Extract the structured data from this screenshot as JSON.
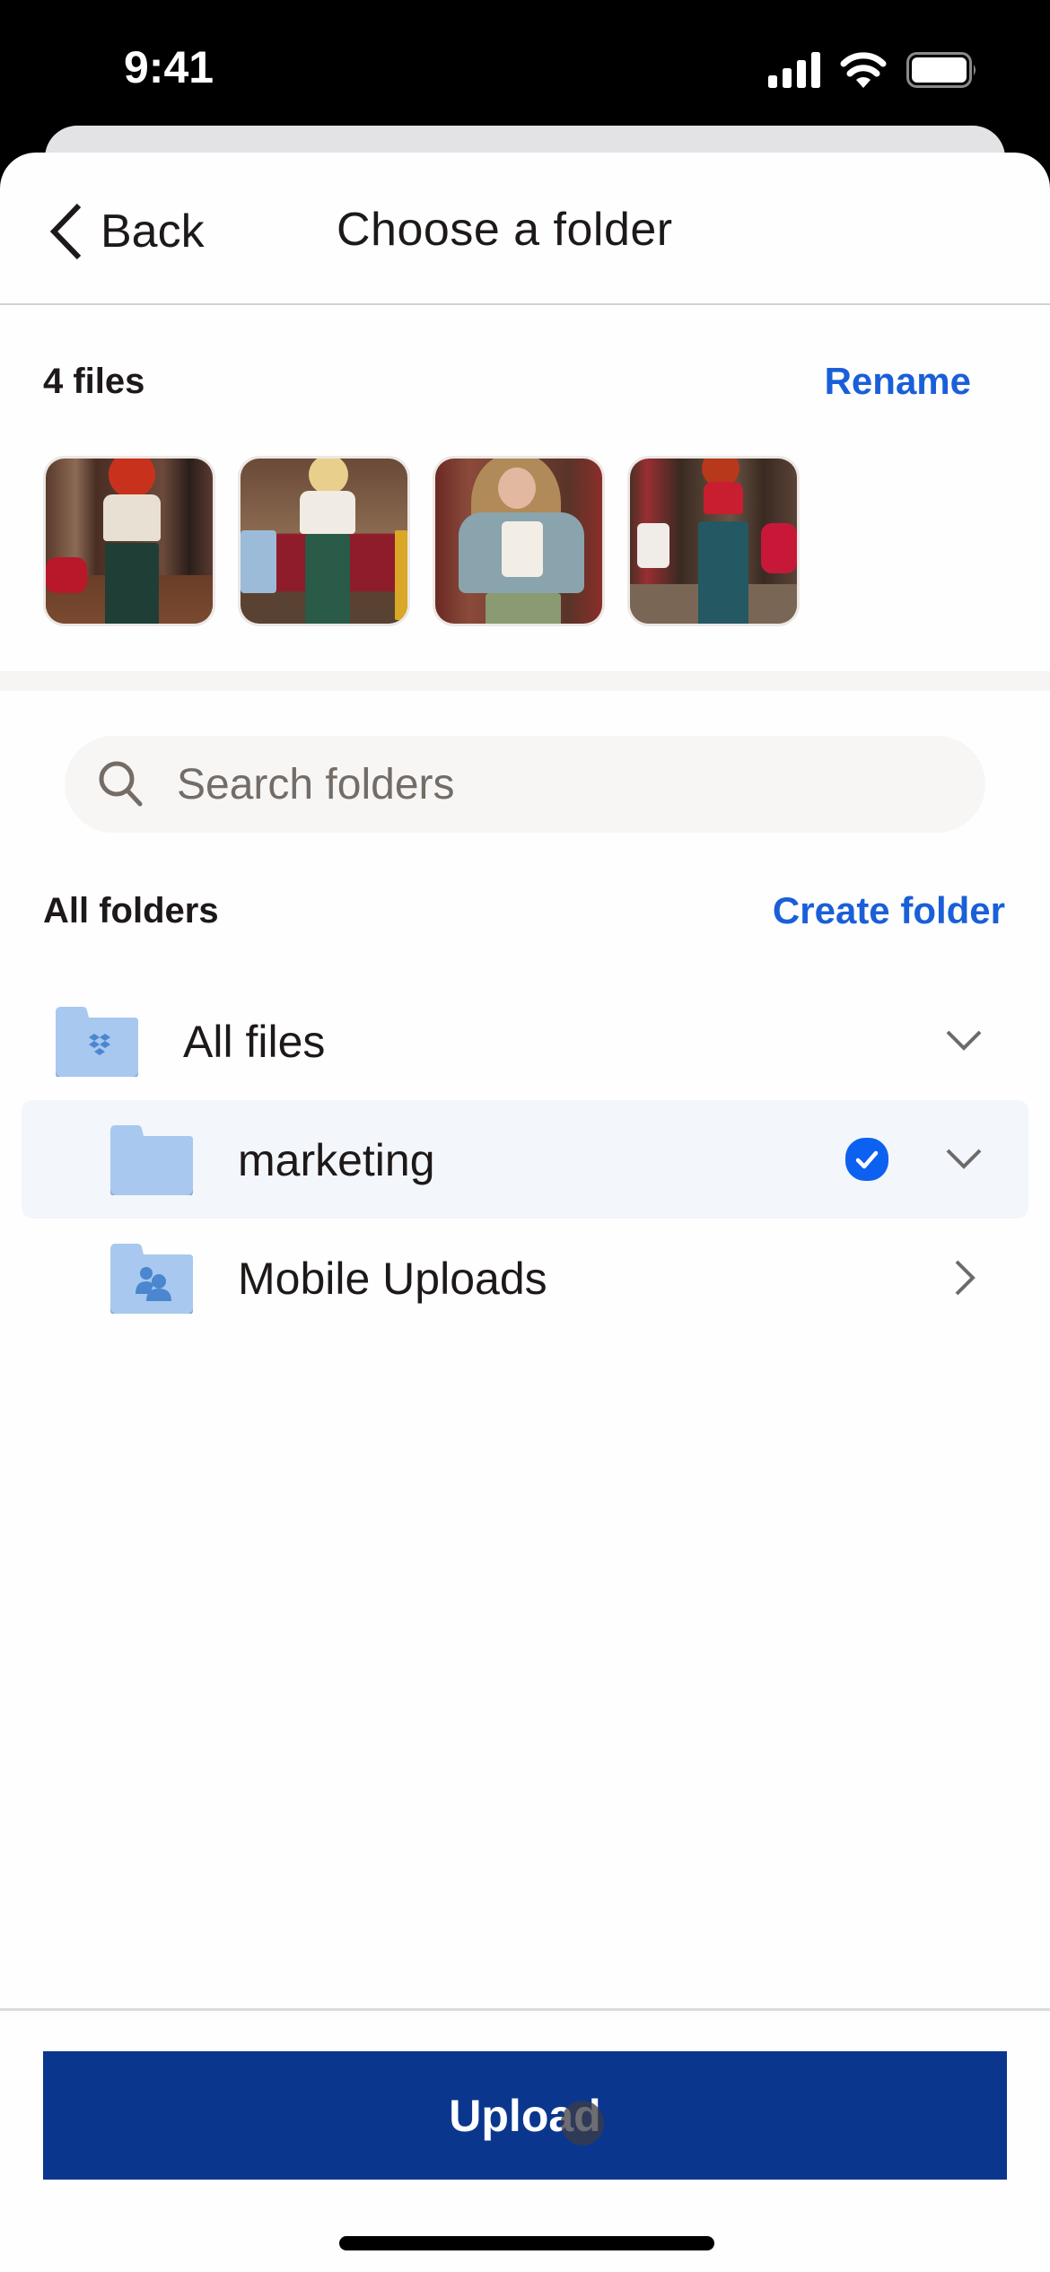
{
  "status_bar": {
    "time": "9:41",
    "icons": [
      "signal-icon",
      "wifi-icon",
      "battery-icon"
    ]
  },
  "nav": {
    "back_label": "Back",
    "title": "Choose a folder",
    "back_icon": "chevron-left-icon"
  },
  "files": {
    "count_label": "4 files",
    "rename_label": "Rename",
    "thumbnails": [
      {
        "name": "photo-1",
        "description": "red-haired woman in white crop top and green wide-leg pants in barbershop"
      },
      {
        "name": "photo-2",
        "description": "blonde woman in white graphic tee and green jeans in barbershop"
      },
      {
        "name": "photo-3",
        "description": "woman with long wavy hair in denim jacket, white crop top, olive pants"
      },
      {
        "name": "photo-4",
        "description": "red-haired woman in red crop top and teal wide-leg pants in barbershop"
      }
    ]
  },
  "search": {
    "placeholder": "Search folders",
    "value": "",
    "icon": "search-icon"
  },
  "folders": {
    "section_title": "All folders",
    "create_label": "Create folder",
    "items": [
      {
        "name": "All files",
        "icon": "dropbox-folder-icon",
        "level": 0,
        "selected": false,
        "toggle": "chevron-down-icon"
      },
      {
        "name": "marketing",
        "icon": "folder-icon",
        "level": 1,
        "selected": true,
        "toggle": "chevron-down-icon"
      },
      {
        "name": "Mobile Uploads",
        "icon": "shared-folder-icon",
        "level": 1,
        "selected": false,
        "toggle": "chevron-right-icon"
      }
    ]
  },
  "footer": {
    "upload_label": "Upload"
  },
  "colors": {
    "accent_blue": "#1a5fd8",
    "check_blue": "#0d61f0",
    "upload_button": "#0a378d",
    "folder_blue": "#a8c8f0",
    "selected_row": "#f3f6fa",
    "text_primary": "#1e1919",
    "text_secondary": "#736c67"
  }
}
